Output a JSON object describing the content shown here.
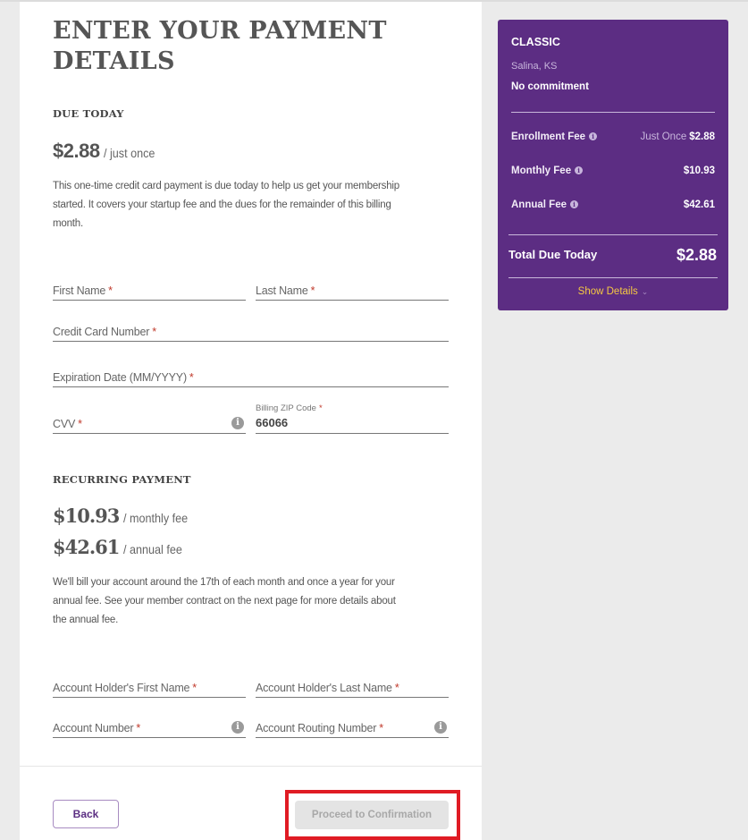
{
  "page": {
    "title": "ENTER YOUR PAYMENT DETAILS"
  },
  "due_today": {
    "heading": "DUE TODAY",
    "amount": "$2.88",
    "suffix": "/ just once",
    "description": "This one-time credit card payment is due today to help us get your membership started. It covers your startup fee and the dues for the remainder of this billing month."
  },
  "card_form": {
    "first_name": {
      "label": "First Name",
      "required": "*"
    },
    "last_name": {
      "label": "Last Name",
      "required": "*"
    },
    "card_number": {
      "label": "Credit Card Number",
      "required": "*"
    },
    "expiration": {
      "label": "Expiration Date (MM/YYYY)",
      "required": "*"
    },
    "cvv": {
      "label": "CVV",
      "required": "*",
      "icon": "info-icon"
    },
    "billing_zip": {
      "label": "Billing ZIP Code",
      "required": "*",
      "value": "66066"
    }
  },
  "recurring": {
    "heading": "RECURRING PAYMENT",
    "monthly_amount": "$10.93",
    "monthly_suffix": "/ monthly fee",
    "annual_amount": "$42.61",
    "annual_suffix": "/ annual fee",
    "description": "We'll bill your account around the 17th of each month and once a year for your annual fee. See your member contract on the next page for more details about the annual fee."
  },
  "bank_form": {
    "holder_first": {
      "label": "Account Holder's First Name",
      "required": "*"
    },
    "holder_last": {
      "label": "Account Holder's Last Name",
      "required": "*"
    },
    "account_number": {
      "label": "Account Number",
      "required": "*",
      "icon": "info-icon"
    },
    "routing_number": {
      "label": "Account Routing Number",
      "required": "*",
      "icon": "info-icon"
    }
  },
  "footer": {
    "back_label": "Back",
    "proceed_label": "Proceed to Confirmation",
    "proceed_disabled": true
  },
  "summary": {
    "plan": "CLASSIC",
    "location": "Salina, KS",
    "commitment": "No commitment",
    "fees": [
      {
        "label": "Enrollment Fee",
        "prefix": "Just Once",
        "value": "$2.88"
      },
      {
        "label": "Monthly Fee",
        "prefix": "",
        "value": "$10.93"
      },
      {
        "label": "Annual Fee",
        "prefix": "",
        "value": "$42.61"
      }
    ],
    "total_label": "Total Due Today",
    "total_value": "$2.88",
    "show_details": "Show Details"
  },
  "colors": {
    "brand_purple": "#5c2d83",
    "accent_yellow": "#f5c842",
    "required_red": "#c0392b",
    "highlight_red": "#e01b24"
  }
}
